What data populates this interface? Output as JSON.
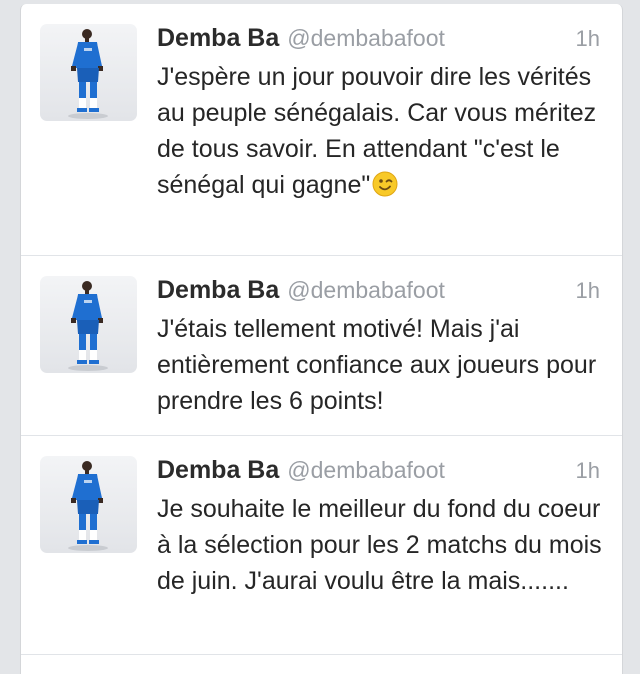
{
  "tweets": [
    {
      "name": "Demba Ba",
      "handle": "@dembabafoot",
      "time": "1h",
      "text": "J'espère un jour pouvoir dire les vérités au peuple sénégalais. Car vous méritez de tous savoir. En attendant \"c'est le sénégal qui gagne\"",
      "emoji": "winking-face-icon"
    },
    {
      "name": "Demba Ba",
      "handle": "@dembabafoot",
      "time": "1h",
      "text": "J'étais tellement motivé! Mais j'ai entièrement confiance aux joueurs pour prendre les 6 points!"
    },
    {
      "name": "Demba Ba",
      "handle": "@dembabafoot",
      "time": "1h",
      "text": "Je souhaite le meilleur du fond du coeur à la sélection pour les 2 matchs du mois de juin. J'aurai voulu être la mais......."
    }
  ],
  "colors": {
    "background": "#e3e5e8",
    "card": "#ffffff",
    "name": "#2b2b2b",
    "meta": "#9a9ea4",
    "kit_blue": "#1f6fd1"
  }
}
